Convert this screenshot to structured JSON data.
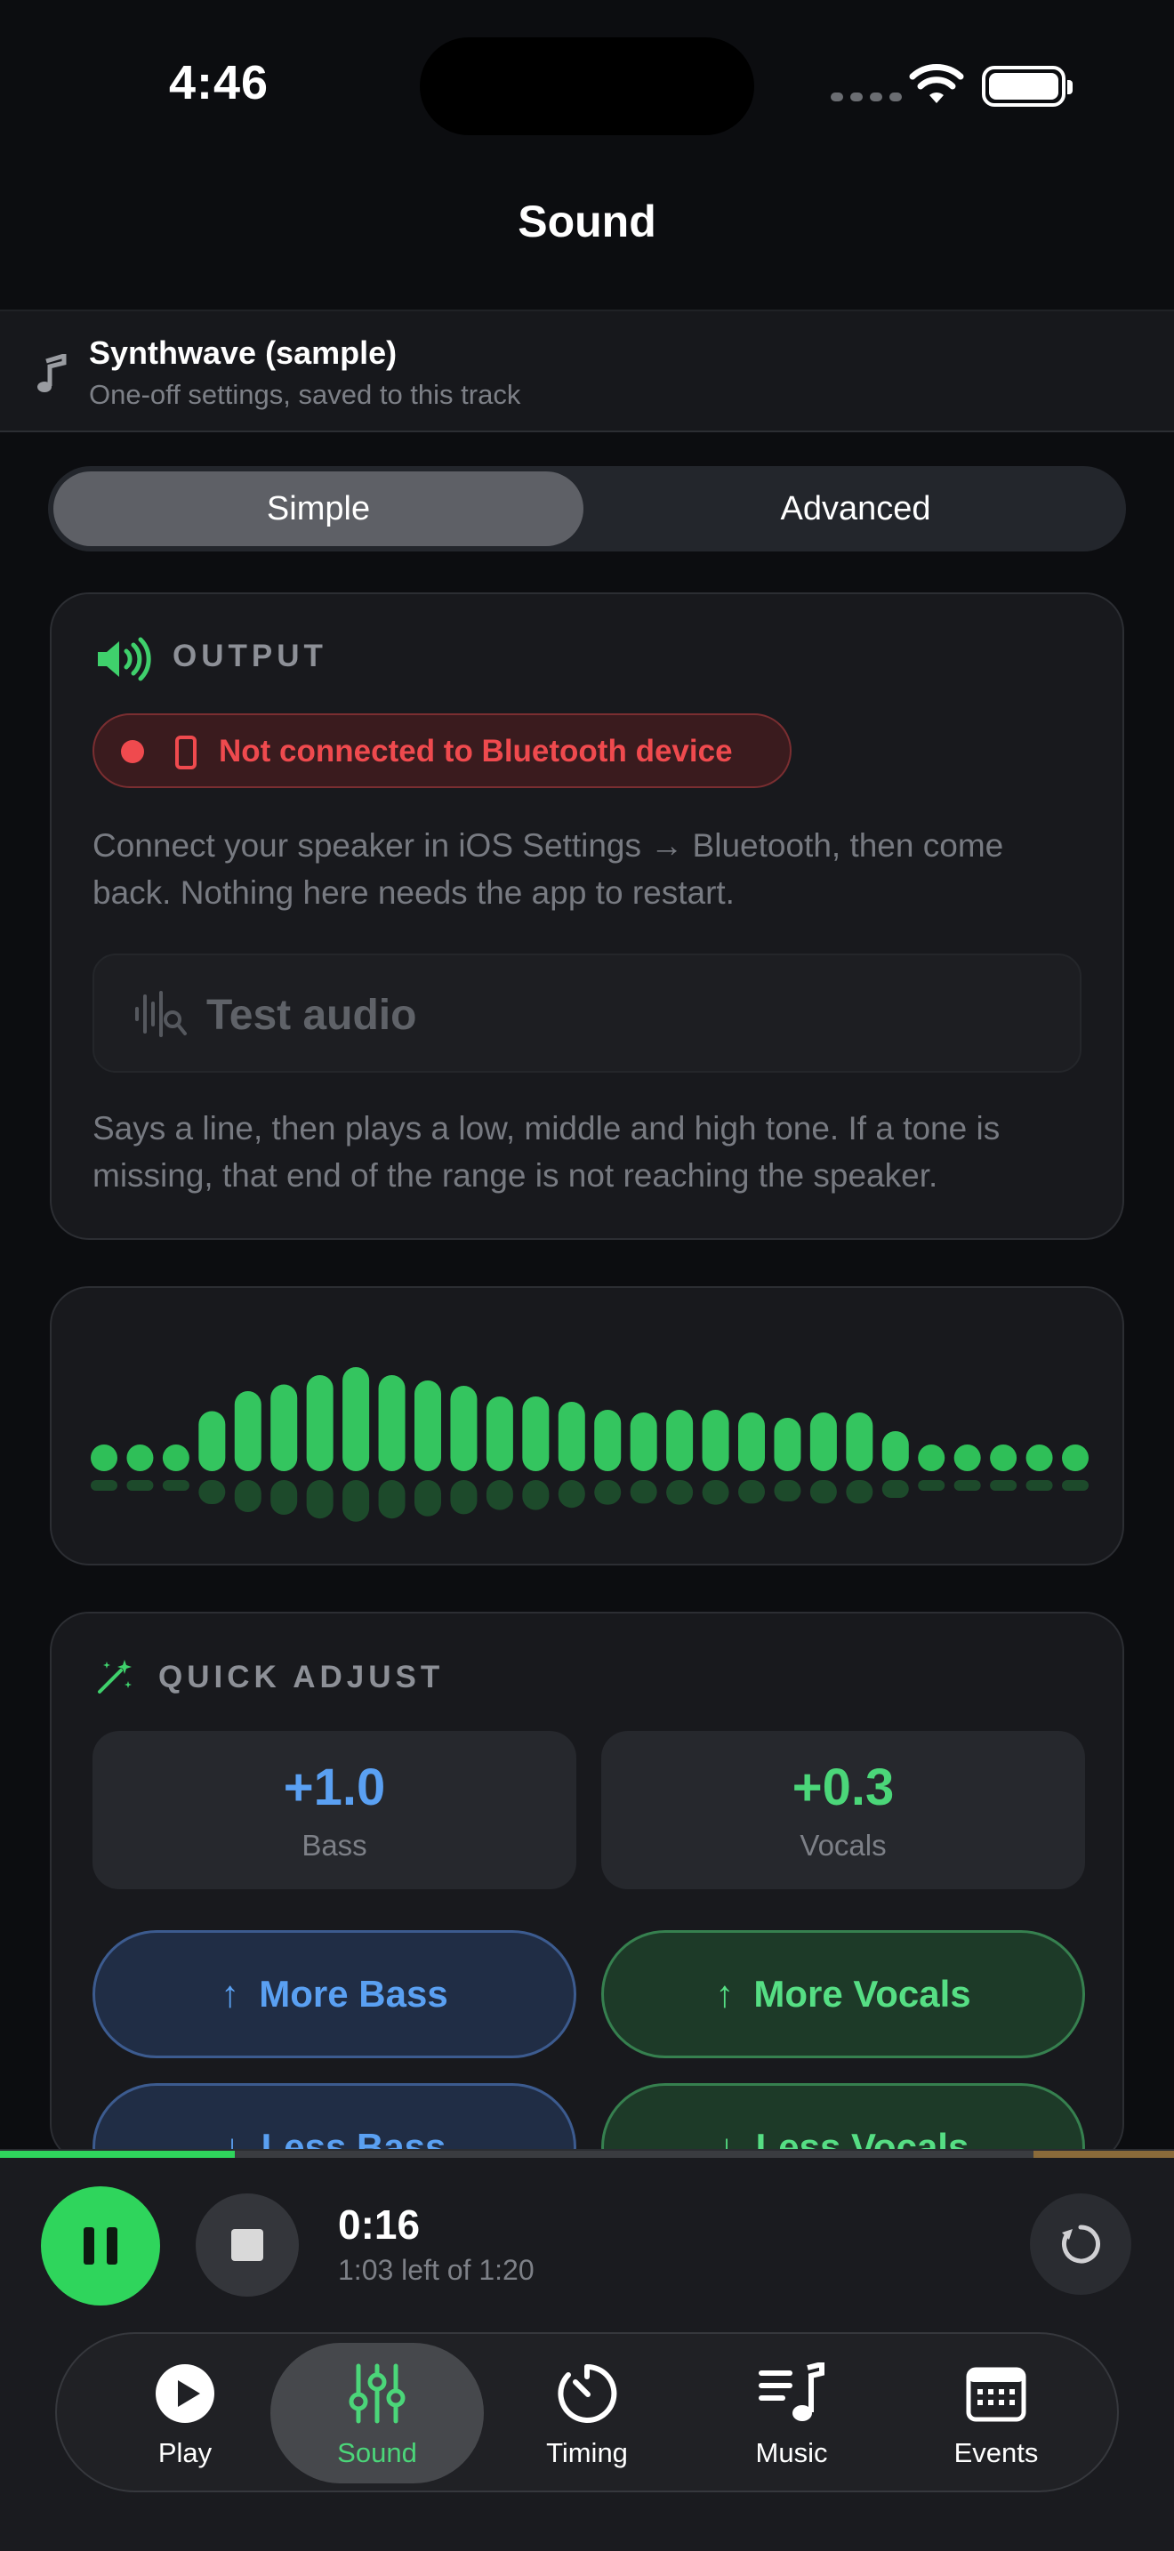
{
  "status_bar": {
    "time": "4:46"
  },
  "nav": {
    "title": "Sound"
  },
  "track": {
    "title": "Synthwave (sample)",
    "subtitle": "One-off settings, saved to this track"
  },
  "mode_tabs": {
    "simple": "Simple",
    "advanced": "Advanced",
    "selected": "Simple"
  },
  "output": {
    "heading": "OUTPUT",
    "bluetooth_status": "Not connected to Bluetooth device",
    "connect_help": "Connect your speaker in iOS Settings → Bluetooth, then come back. Nothing here needs the app to restart.",
    "test_button": "Test audio",
    "test_help": "Says a line, then plays a low, middle and high tone. If a tone is missing, that end of the range is not reaching the speaker."
  },
  "spectrum": {
    "levels": [
      0.1,
      0.1,
      0.1,
      0.45,
      0.6,
      0.65,
      0.72,
      0.78,
      0.72,
      0.68,
      0.64,
      0.56,
      0.56,
      0.52,
      0.46,
      0.44,
      0.46,
      0.46,
      0.44,
      0.4,
      0.44,
      0.44,
      0.3,
      0.1,
      0.1,
      0.1,
      0.1,
      0.1
    ]
  },
  "quick_adjust": {
    "heading": "QUICK ADJUST",
    "bass": {
      "value": "+1.0",
      "label": "Bass"
    },
    "vocals": {
      "value": "+0.3",
      "label": "Vocals"
    },
    "more_bass": "More Bass",
    "more_vocals": "More Vocals",
    "less_bass": "Less Bass",
    "less_vocals": "Less Vocals"
  },
  "player": {
    "elapsed": "0:16",
    "remaining": "1:03 left of 1:20",
    "progress_fraction": 0.2,
    "buffer_tail_fraction": 0.12
  },
  "tabs": [
    {
      "label": "Play",
      "icon": "play-circle-icon"
    },
    {
      "label": "Sound",
      "icon": "sliders-icon",
      "active": true
    },
    {
      "label": "Timing",
      "icon": "timer-icon"
    },
    {
      "label": "Music",
      "icon": "music-list-icon"
    },
    {
      "label": "Events",
      "icon": "calendar-icon"
    }
  ],
  "colors": {
    "accent_green": "#2fd55c",
    "accent_blue": "#5aa0f2",
    "error_red": "#ef4a4e"
  }
}
